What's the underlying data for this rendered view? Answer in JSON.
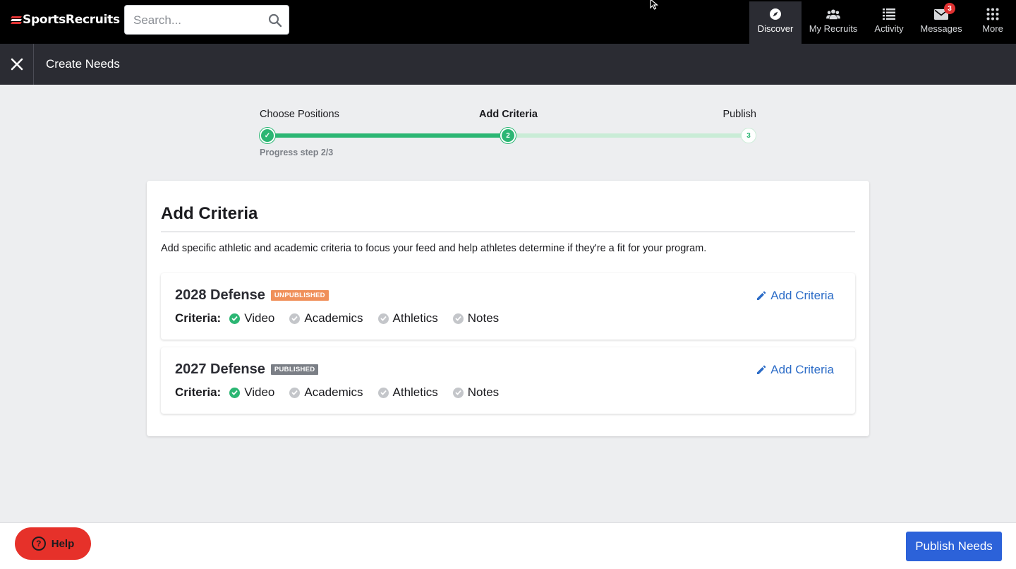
{
  "app": {
    "logo_text": "SportsRecruits",
    "search_placeholder": "Search..."
  },
  "nav": {
    "items": [
      {
        "label": "Discover",
        "icon": "compass-icon",
        "active": true
      },
      {
        "label": "My Recruits",
        "icon": "people-icon"
      },
      {
        "label": "Activity",
        "icon": "list-icon"
      },
      {
        "label": "Messages",
        "icon": "mail-icon",
        "badge": "3"
      },
      {
        "label": "More",
        "icon": "grid-icon"
      }
    ]
  },
  "subheader": {
    "title": "Create Needs"
  },
  "stepper": {
    "steps": [
      {
        "label": "Choose Positions",
        "marker": "✓",
        "state": "done"
      },
      {
        "label": "Add Criteria",
        "marker": "2",
        "state": "current"
      },
      {
        "label": "Publish",
        "marker": "3",
        "state": "todo"
      }
    ],
    "progress_text": "Progress step 2/3",
    "progress_fraction": 0.5
  },
  "card": {
    "title": "Add Criteria",
    "description": "Add specific athletic and academic criteria to focus your feed and help athletes determine if they're a fit for your program.",
    "needs": [
      {
        "title": "2028 Defense",
        "status": "UNPUBLISHED",
        "status_color": "#f0905a",
        "action": "Add Criteria",
        "criteria_label": "Criteria:",
        "criteria": [
          {
            "label": "Video",
            "checked": true
          },
          {
            "label": "Academics",
            "checked": false
          },
          {
            "label": "Athletics",
            "checked": false
          },
          {
            "label": "Notes",
            "checked": false
          }
        ]
      },
      {
        "title": "2027 Defense",
        "status": "PUBLISHED",
        "status_color": "#7b7f86",
        "action": "Add Criteria",
        "criteria_label": "Criteria:",
        "criteria": [
          {
            "label": "Video",
            "checked": true
          },
          {
            "label": "Academics",
            "checked": false
          },
          {
            "label": "Athletics",
            "checked": false
          },
          {
            "label": "Notes",
            "checked": false
          }
        ]
      }
    ]
  },
  "footer": {
    "help_label": "Help",
    "publish_label": "Publish Needs"
  },
  "colors": {
    "accent_green": "#2bb673",
    "link_blue": "#2c6cc7",
    "primary_button": "#2c62d9",
    "help_red": "#e6312a",
    "check_gray": "#c4c6ca"
  }
}
